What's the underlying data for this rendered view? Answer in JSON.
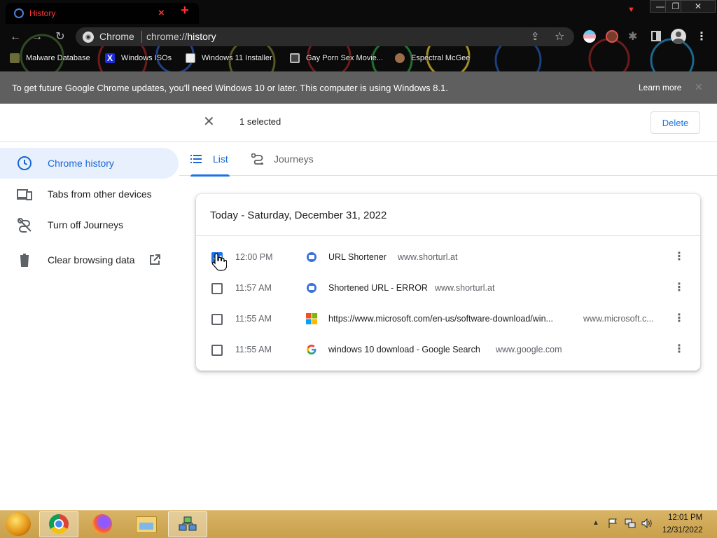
{
  "window": {
    "tab_title": "History",
    "tab_strip_dropdown": "▼",
    "controls": {
      "minimize": "—",
      "maximize": "❐",
      "close": "✕"
    }
  },
  "omnibox": {
    "chip": "Chrome",
    "url_prefix": "chrome://",
    "url_host": "history"
  },
  "bookmarks": [
    {
      "label": "Malware Database",
      "icon": "bookmark-favicon"
    },
    {
      "label": "Windows ISOs",
      "icon": "x-logo-icon"
    },
    {
      "label": "Windows 11 Installer",
      "icon": "image-icon"
    },
    {
      "label": "Gay Porn Sex Movie...",
      "icon": "globe-icon"
    },
    {
      "label": "Espectral McGee",
      "icon": "avatar-icon"
    }
  ],
  "banner": {
    "text": "To get future Google Chrome updates, you'll need Windows 10 or later. This computer is using Windows 8.1.",
    "link": "Learn more"
  },
  "selection": {
    "count_label": "1 selected",
    "delete_label": "Delete"
  },
  "sidebar": {
    "items": [
      {
        "label": "Chrome history",
        "icon": "clock-icon",
        "active": true
      },
      {
        "label": "Tabs from other devices",
        "icon": "devices-icon"
      },
      {
        "label": "Turn off Journeys",
        "icon": "journeys-off-icon"
      },
      {
        "label": "Clear browsing data",
        "icon": "trash-icon"
      }
    ]
  },
  "tabs": [
    {
      "label": "List",
      "icon": "list-icon",
      "selected": true
    },
    {
      "label": "Journeys",
      "icon": "journeys-icon",
      "selected": false
    }
  ],
  "history": {
    "date_heading": "Today - Saturday, December 31, 2022",
    "rows": [
      {
        "checked": true,
        "time": "12:00 PM",
        "favicon": "shorturl-favicon",
        "title": "URL Shortener",
        "domain": "www.shorturl.at"
      },
      {
        "checked": false,
        "time": "11:57 AM",
        "favicon": "shorturl-favicon",
        "title": "Shortened URL - ERROR",
        "domain": "www.shorturl.at"
      },
      {
        "checked": false,
        "time": "11:55 AM",
        "favicon": "microsoft-favicon",
        "title": "https://www.microsoft.com/en-us/software-download/win...",
        "domain": "www.microsoft.c..."
      },
      {
        "checked": false,
        "time": "11:55 AM",
        "favicon": "google-favicon",
        "title": "windows 10 download - Google Search",
        "domain": "www.google.com"
      }
    ]
  },
  "taskbar": {
    "clock_time": "12:01 PM",
    "clock_date": "12/31/2022"
  },
  "colors": {
    "accent": "#1a73e8",
    "active_nav_bg": "#e8f0fe",
    "banner_bg": "#5f5f5f",
    "frame_bg": "#0b0b0b",
    "tab_text": "#ff3b3b",
    "taskbar": "#d1aa55"
  }
}
